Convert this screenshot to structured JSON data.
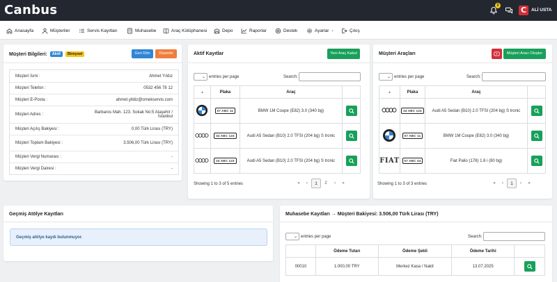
{
  "topbar": {
    "brand": "Canbus",
    "notification_count": "0",
    "logo_letter": "C",
    "user_name": "ALİ USTA"
  },
  "nav": [
    {
      "label": "Anasayfa",
      "icon": "home-icon"
    },
    {
      "label": "Müşteriler",
      "icon": "user-icon"
    },
    {
      "label": "Servis Kayıtları",
      "icon": "list-icon"
    },
    {
      "label": "Muhasebe",
      "icon": "calculator-icon"
    },
    {
      "label": "Araç Kütüphanesi",
      "icon": "book-icon"
    },
    {
      "label": "Depo",
      "icon": "warehouse-icon"
    },
    {
      "label": "Raporlar",
      "icon": "chart-icon"
    },
    {
      "label": "Destek",
      "icon": "support-icon"
    },
    {
      "label": "Ayarlar",
      "icon": "gear-icon"
    },
    {
      "label": "Çıkış",
      "icon": "logout-icon"
    }
  ],
  "customer": {
    "title": "Müşteri Bilgileri:",
    "badge_active": "Aktif",
    "badge_type": "Bireysel",
    "btn_back": "Geri Dön",
    "btn_edit": "Düzenle",
    "rows": [
      {
        "label": "Müşteri İsmi :",
        "value": "Ahmet Yıldız"
      },
      {
        "label": "Müşteri Telefon :",
        "value": "0532 456 78 12"
      },
      {
        "label": "Müşteri E-Posta :",
        "value": "ahmet.yildiz@ornekservis.com"
      },
      {
        "label": "Müşteri Adres :",
        "value": "Barbaros Mah. 123. Sokak No:5 Ataşehir / İstanbul"
      },
      {
        "label": "Müşteri Açılış Bakiyesi :",
        "value": "0,00 Türk Lirası (TRY)"
      },
      {
        "label": "Müşteri Toplam Bakiyesi :",
        "value": "3.506,00 Türk Lirası (TRY)"
      },
      {
        "label": "Müşteri Vergi Numarası :",
        "value": "-"
      },
      {
        "label": "Müşteri Vergi Dairesi :",
        "value": "-"
      }
    ]
  },
  "active_records": {
    "title": "Aktif Kayıtlar",
    "btn_new": "Yeni Araç Kabul",
    "entries_label": "entries per page",
    "search_label": "Search:",
    "columns": [
      "Plaka",
      "Araç"
    ],
    "rows": [
      {
        "brand": "BMW",
        "plate": "07 ABC 11",
        "vehicle": "BMW 1M Coupe (E82) 3.0 (340 bg)"
      },
      {
        "brand": "Audi",
        "plate": "34 ABC 123",
        "vehicle": "Audi A5 Sedan (B10) 2.0 TFSI (204 bg) S tronic"
      },
      {
        "brand": "Audi",
        "plate": "34 ABC 123",
        "vehicle": "Audi A5 Sedan (B10) 2.0 TFSI (204 bg) S tronic"
      }
    ],
    "info": "Showing 1 to 3 of 5 entries",
    "pages": [
      "«",
      "‹",
      "1",
      "2",
      "›",
      "»"
    ]
  },
  "vehicles": {
    "title": "Müşteri Araçları",
    "btn_create": "Müşteri Aracı Oluştur",
    "entries_label": "entries per page",
    "search_label": "Search:",
    "columns": [
      "Plaka",
      "Araç"
    ],
    "rows": [
      {
        "brand": "Audi",
        "plate": "34 ABC 123",
        "vehicle": "Audi A5 Sedan (B10) 2.0 TFSI (204 bg) S tronic"
      },
      {
        "brand": "BMW",
        "plate": "07 ABC 11",
        "vehicle": "BMW 1M Coupe (E82) 3.0 (340 bg)"
      },
      {
        "brand": "FIAT",
        "plate": "07 ABC 44",
        "vehicle": "Fiat Palio (178) 1.6 i (80 bg)"
      }
    ],
    "info": "Showing 1 to 3 of 3 entries",
    "pages": [
      "«",
      "‹",
      "1",
      "›",
      "»"
    ]
  },
  "history": {
    "title": "Geçmiş Atölye Kayıtları",
    "empty": "Geçmiş atölye kaydı bulunmuyor."
  },
  "accounting": {
    "title": "Muhasebe Kayıtları → Müşteri Bakiyesi: 3.506,00 Türk Lirası (TRY)",
    "entries_label": "entries per page",
    "search_label": "Search:",
    "columns": [
      "Ödeme Tutarı",
      "Ödeme Şekli",
      "Ödeme Tarihi"
    ],
    "rows": [
      {
        "no": "00010",
        "amount": "1.000,00 TRY",
        "method": "Merkez Kasa / Nakit",
        "date": "13.07.2025"
      }
    ]
  },
  "colors": {
    "topbar": "#23272f",
    "primary": "#2f86d6",
    "warning": "#ef7d3c",
    "success": "#18a05a",
    "danger": "#d32f3a",
    "badge_active": "#2f86d6",
    "badge_type": "#f5c518"
  }
}
